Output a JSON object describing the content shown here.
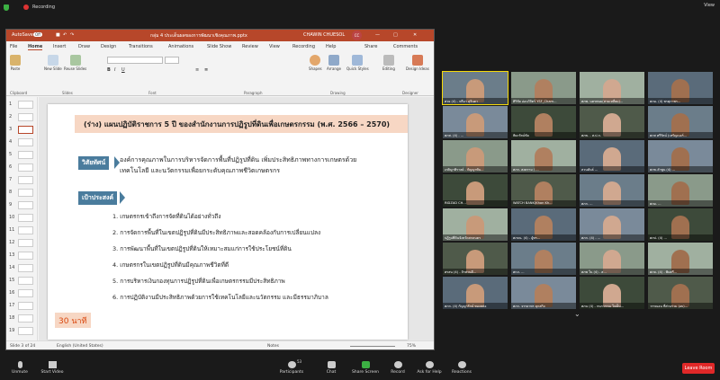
{
  "top_bar": {
    "recording": "Recording",
    "view": "View"
  },
  "ppt": {
    "autosave": "AutoSave",
    "autosave_state": "Off",
    "filename": "กลุ่ม 4 ประเด็นผลของการพัฒนาเชิงคุณภาพ.pptx",
    "user": "CHAWIN CHUESOL",
    "user_initials": "CC",
    "menu": [
      "File",
      "Home",
      "Insert",
      "Draw",
      "Design",
      "Transitions",
      "Animations",
      "Slide Show",
      "Review",
      "View",
      "Recording",
      "Help"
    ],
    "share": "Share",
    "comments": "Comments",
    "ribbon_groups": [
      "Clipboard",
      "Slides",
      "Font",
      "Paragraph",
      "Drawing",
      "Designer"
    ],
    "ribbon_buttons": {
      "paste": "Paste",
      "new_slide": "New Slide",
      "reuse_slides": "Reuse Slides",
      "shapes": "Shapes",
      "arrange": "Arrange",
      "quick_styles": "Quick Styles",
      "editing": "Editing",
      "design_ideas": "Design Ideas"
    },
    "slide_numbers": [
      "1",
      "2",
      "3",
      "4",
      "5",
      "6",
      "7",
      "8",
      "9",
      "10",
      "11",
      "12",
      "13",
      "14",
      "15",
      "16",
      "17",
      "18",
      "19"
    ],
    "slide": {
      "title": "(ร่าง) แผนปฏิบัติราชการ 5 ปี ของสำนักงานการปฏิรูปที่ดินเพื่อเกษตรกรรม (พ.ศ. 2566 – 2570)",
      "vision_label": "วิสัยทัศน์",
      "vision_line1": "องค์การคุณภาพในการบริหารจัดการพื้นที่ปฏิรูปที่ดิน เพิ่มประสิทธิภาพทางการเกษตรด้วย",
      "vision_line2": "เทคโนโลยี และนวัตกรรมเพื่อยกระดับคุณภาพชีวิตเกษตรกร",
      "goal_label": "เป้าประสงค์",
      "goals": [
        "1. เกษตรกรเข้าถึงการจัดที่ดินได้อย่างทั่วถึง",
        "2. การจัดการพื้นที่ในเขตปฏิรูปที่ดินมีประสิทธิภาพและสอดคล้องกับการเปลี่ยนแปลง",
        "3. การพัฒนาพื้นที่ในเขตปฏิรูปที่ดินให้เหมาะสมแก่การใช้ประโยชน์ที่ดิน",
        "4. เกษตรกรในเขตปฏิรูปที่ดินมีคุณภาพชีวิตที่ดี",
        "5. การบริหารเงินกองทุนการปฏิรูปที่ดินเพื่อเกษตรกรรมมีประสิทธิภาพ",
        "6. การปฏิบัติงานมีประสิทธิภาพด้วยการใช้เทคโนโลยีและนวัตกรรม และมีธรรมาภิบาล"
      ],
      "time": "30 นาที"
    },
    "status": {
      "slide": "Slide 3 of 24",
      "language": "English (United States)",
      "notes": "Notes",
      "zoom": "75%"
    }
  },
  "participants": [
    {
      "name": "ศวย (4) - พรีมา สุจินดา"
    },
    {
      "name": "ศิริชัย อ่อนวิจิตร์ YSF_Cham..."
    },
    {
      "name": "ศภพ. นครพนม(สามเหลี่ยม)..."
    },
    {
      "name": "ศภม. (4) พรศุภาพร..."
    },
    {
      "name": "ศภส. (4) - ..."
    },
    {
      "name": "พิยะรัตน์ชัย"
    },
    {
      "name": "ศภข. - ส.ป.ก."
    },
    {
      "name": "ศภส ศรีรัตน์ (เหรัญเบอร์..."
    },
    {
      "name": "เกศิญาพิราลย์ - กัญญาพัน..."
    },
    {
      "name": "ศภก. สงคราม / ..."
    },
    {
      "name": "สวนคันธ์ ..."
    },
    {
      "name": "ศภข.ลำพูน (4) ..."
    },
    {
      "name": "RIDZAD CH..."
    },
    {
      "name": "WATCH BANK(Khon Kh..."
    },
    {
      "name": "ศภก. ..."
    },
    {
      "name": "ศภผ. ..."
    },
    {
      "name": "ปฏิรูปที่ดินจังหวัดสกลนคร"
    },
    {
      "name": "ศภธน. (4) - ผู้ทร..."
    },
    {
      "name": "ศภก. (4) - ..."
    },
    {
      "name": "ศภป. (4) ..."
    },
    {
      "name": "ศรสน (4) - ถิรสานดี..."
    },
    {
      "name": "ศกภ. ..."
    },
    {
      "name": "ศภพ ใน (4) - ส..."
    },
    {
      "name": "ศภล. (4) - พิมศรี..."
    },
    {
      "name": "ศภก. (4) กัญญารักน์ ทองหล่อ"
    },
    {
      "name": "ศภก. จรรยาพร คุกสกิจ"
    },
    {
      "name": "ศภน (4) - กนกวรรณ ใจเย็น..."
    },
    {
      "name": "วรรณอน ที่ส่วนร่วม (อบ)..."
    }
  ],
  "bottom_bar": {
    "unmute": "Unmute",
    "start_video": "Start Video",
    "participants": "Participants",
    "participants_count": "53",
    "chat": "Chat",
    "share_screen": "Share Screen",
    "record": "Record",
    "ask_for_help": "Ask for Help",
    "reactions": "Reactions",
    "leave": "Leave Room"
  },
  "colors": {
    "ppt_brand": "#b7472a",
    "slide_label": "#4a7c9d",
    "slide_title_bg": "#f7d7c4",
    "leave": "#e02828",
    "share_screen": "#3cb043"
  }
}
